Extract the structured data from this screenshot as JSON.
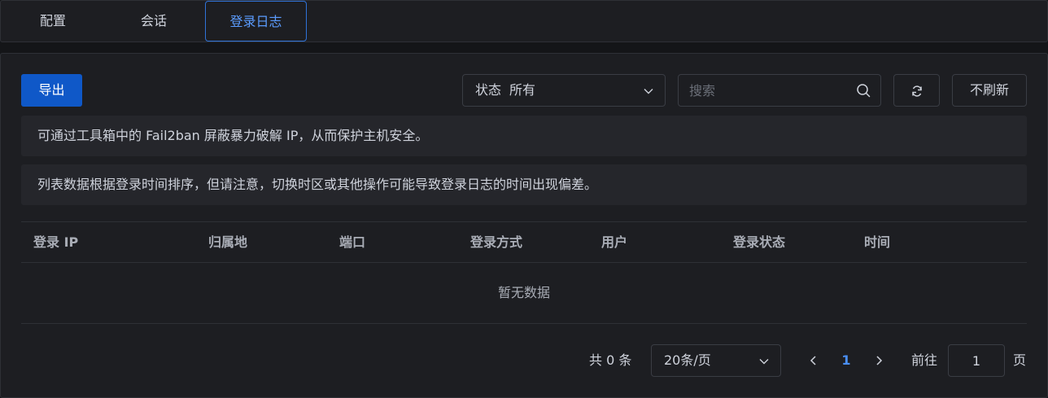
{
  "tabs": [
    {
      "label": "配置"
    },
    {
      "label": "会话"
    },
    {
      "label": "登录日志",
      "active": true
    }
  ],
  "toolbar": {
    "export_label": "导出",
    "status_filter": {
      "label": "状态",
      "value": "所有"
    },
    "search_placeholder": "搜索",
    "refresh_icon": "refresh-icon",
    "no_refresh_label": "不刷新"
  },
  "notices": [
    "可通过工具箱中的 Fail2ban 屏蔽暴力破解 IP，从而保护主机安全。",
    "列表数据根据登录时间排序，但请注意，切换时区或其他操作可能导致登录日志的时间出现偏差。"
  ],
  "table": {
    "columns": [
      "登录 IP",
      "归属地",
      "端口",
      "登录方式",
      "用户",
      "登录状态",
      "时间"
    ],
    "empty_text": "暂无数据"
  },
  "pagination": {
    "total_text": "共 0 条",
    "page_size": "20条/页",
    "current_page": "1",
    "goto_label": "前往",
    "goto_value": "1",
    "page_unit": "页"
  },
  "colors": {
    "accent": "#0f58c8",
    "active_tab": "#5b9cff",
    "page_active": "#4a8ff5"
  }
}
